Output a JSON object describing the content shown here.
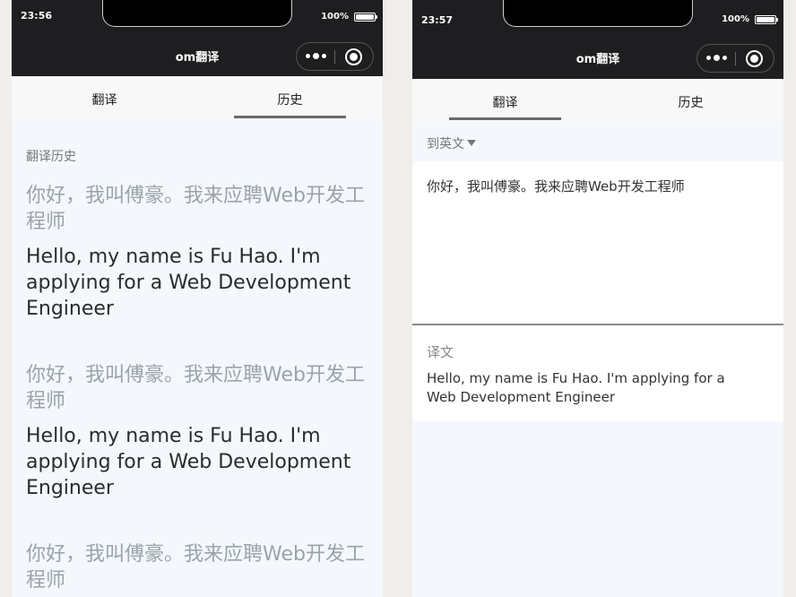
{
  "left": {
    "status": {
      "time": "23:56",
      "battery": "100%"
    },
    "title": "om翻译",
    "tabs": [
      "翻译",
      "历史"
    ],
    "history_title": "翻译历史",
    "history": [
      {
        "src": "你好，我叫傅豪。我来应聘Web开发工程师",
        "dst": "Hello, my name is Fu Hao. I'm applying for a Web Development Engineer"
      },
      {
        "src": "你好，我叫傅豪。我来应聘Web开发工程师",
        "dst": "Hello, my name is Fu Hao. I'm applying for a Web Development Engineer"
      },
      {
        "src": "你好，我叫傅豪。我来应聘Web开发工程师",
        "dst": ""
      }
    ]
  },
  "right": {
    "status": {
      "time": "23:57",
      "battery": "100%"
    },
    "title": "om翻译",
    "tabs": [
      "翻译",
      "历史"
    ],
    "language": "到英文",
    "input_text": "你好，我叫傅豪。我来应聘Web开发工程师",
    "result_label": "译文",
    "result_text": "Hello, my name is Fu Hao. I'm applying for a Web Development Engineer"
  }
}
